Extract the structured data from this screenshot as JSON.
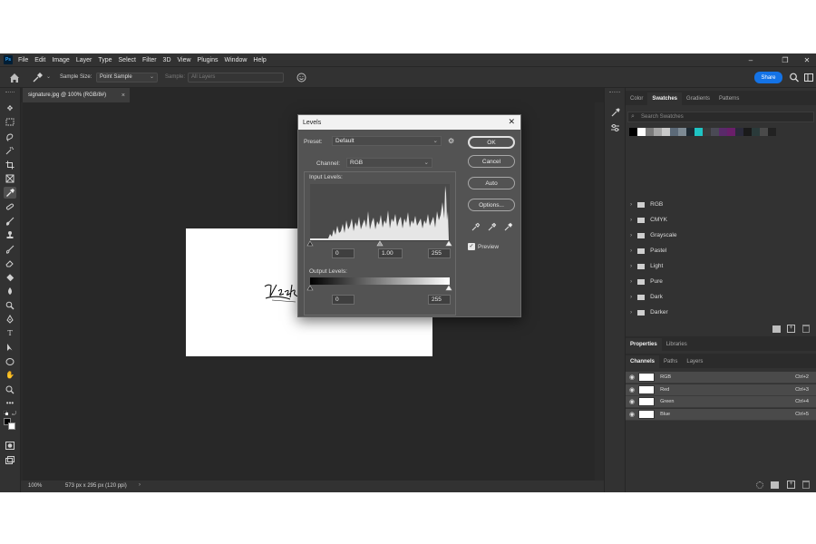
{
  "menu": {
    "logo": "Ps",
    "items": [
      "File",
      "Edit",
      "Image",
      "Layer",
      "Type",
      "Select",
      "Filter",
      "3D",
      "View",
      "Plugins",
      "Window",
      "Help"
    ]
  },
  "options_bar": {
    "sample_size_label": "Sample Size:",
    "sample_size_value": "Point Sample",
    "sample_label": "Sample:",
    "sample_value": "All Layers",
    "share_label": "Share"
  },
  "document": {
    "tab_title": "signature.jpg @ 100% (RGB/8#)",
    "close_symbol": "×",
    "signature_text": "Vesk"
  },
  "status_bar": {
    "zoom": "100%",
    "info": "573 px x 295 px (120 ppi)"
  },
  "swatches_panel": {
    "tabs": [
      "Color",
      "Swatches",
      "Gradients",
      "Patterns"
    ],
    "active_tab": "Swatches",
    "search_placeholder": "Search Swatches",
    "swatch_colors": [
      "#000000",
      "#ffffff",
      "#7a7a7a",
      "#a5a5a5",
      "#c9c9c9",
      "#5c6a78",
      "#7d8a94",
      "#1e2a33",
      "#1fc4c4",
      "#3a3a3a",
      "#4a4a55",
      "#5a2a6a",
      "#6a1f6a",
      "#2a2a3a",
      "#1a1a1a",
      "#2a3a3a",
      "#4a4a4a",
      "#222222"
    ],
    "folders": [
      "RGB",
      "CMYK",
      "Grayscale",
      "Pastel",
      "Light",
      "Pure",
      "Dark",
      "Darker"
    ]
  },
  "properties_panel": {
    "tabs": [
      "Properties",
      "Libraries"
    ]
  },
  "channels_panel": {
    "tabs": [
      "Channels",
      "Paths",
      "Layers"
    ],
    "channels": [
      {
        "name": "RGB",
        "shortcut": "Ctrl+2"
      },
      {
        "name": "Red",
        "shortcut": "Ctrl+3"
      },
      {
        "name": "Green",
        "shortcut": "Ctrl+4"
      },
      {
        "name": "Blue",
        "shortcut": "Ctrl+5"
      }
    ]
  },
  "levels_dialog": {
    "title": "Levels",
    "close_symbol": "✕",
    "preset_label": "Preset:",
    "preset_value": "Default",
    "channel_label": "Channel:",
    "channel_value": "RGB",
    "input_levels_label": "Input Levels:",
    "input_black": "0",
    "input_gamma": "1.00",
    "input_white": "255",
    "output_levels_label": "Output Levels:",
    "output_black": "0",
    "output_white": "255",
    "buttons": {
      "ok": "OK",
      "cancel": "Cancel",
      "auto": "Auto",
      "options": "Options..."
    },
    "preview_label": "Preview",
    "preview_checked": true
  },
  "colors": {
    "app_bg": "#2b2b2b",
    "panel_bg": "#323232",
    "dialog_bg": "#535353",
    "accent": "#1473e6"
  }
}
